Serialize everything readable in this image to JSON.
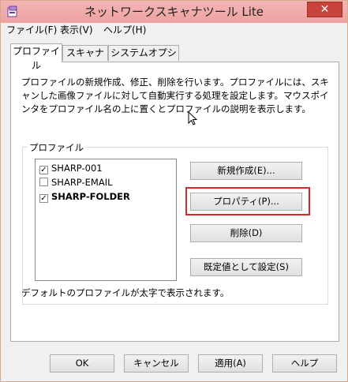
{
  "window": {
    "title": "ネットワークスキャナツール Lite",
    "close_symbol": "✕"
  },
  "menu": [
    {
      "label": "ファイル(F)"
    },
    {
      "label": "表示(V)"
    },
    {
      "label": "ヘルプ(H)"
    }
  ],
  "tabs": [
    {
      "label": "プロファイル"
    },
    {
      "label": "スキャナ"
    },
    {
      "label": "システムオプション"
    }
  ],
  "panel": {
    "description": "プロファイルの新規作成、修正、削除を行います。プロファイルには、スキャンした画像ファイルに対して自動実行する処理を設定します。マウスポインタをプロファイル名の上に置くとプロファイルの説明を表示します。",
    "group_label": "プロファイル",
    "profiles": [
      {
        "name": "SHARP-001",
        "checked": "✓"
      },
      {
        "name": "SHARP-EMAIL",
        "checked": ""
      },
      {
        "name": "SHARP-FOLDER",
        "checked": "✓"
      }
    ],
    "buttons": {
      "new": "新規作成(E)...",
      "properties": "プロパティ(P)...",
      "delete": "削除(D)",
      "set_default": "既定値として設定(S)"
    },
    "hint": "デフォルトのプロファイルが太字で表示されます。"
  },
  "footer": {
    "ok": "OK",
    "cancel": "キャンセル",
    "apply": "適用(A)",
    "help": "ヘルプ"
  },
  "colors": {
    "titlebar": "#efa5a4",
    "close_button": "#c7433c",
    "highlight": "#d9292a"
  }
}
